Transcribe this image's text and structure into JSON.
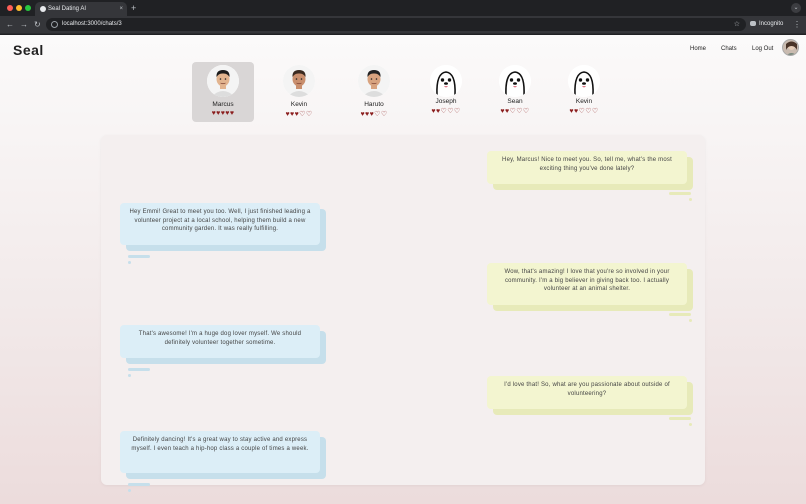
{
  "browser": {
    "tab_title": "Seal Dating AI",
    "tab_close": "×",
    "new_tab": "+",
    "url": "localhost:3000/chats/3",
    "incognito_label": "Incognito"
  },
  "app": {
    "logo": "Seal",
    "nav": {
      "home": "Home",
      "chats": "Chats",
      "logout": "Log Out"
    }
  },
  "matches": [
    {
      "name": "Marcus",
      "hearts": "♥♥♥♥♥",
      "active": true
    },
    {
      "name": "Kevin",
      "hearts": "♥♥♥♡♡",
      "active": false
    },
    {
      "name": "Haruto",
      "hearts": "♥♥♥♡♡",
      "active": false
    },
    {
      "name": "Joseph",
      "hearts": "♥♥♡♡♡",
      "active": false
    },
    {
      "name": "Sean",
      "hearts": "♥♥♡♡♡",
      "active": false
    },
    {
      "name": "Kevin",
      "hearts": "♥♥♡♡♡",
      "active": false
    }
  ],
  "messages": [
    {
      "from": "me",
      "text": "Hey, Marcus! Nice to meet you. So, tell me, what's the most exciting thing you've done lately?"
    },
    {
      "from": "them",
      "text": "Hey Emmi! Great to meet you too. Well, I just finished leading a volunteer project at a local school, helping them build a new community garden. It was really fulfilling."
    },
    {
      "from": "me",
      "text": "Wow, that's amazing! I love that you're so involved in your community. I'm a big believer in giving back too. I actually volunteer at an animal shelter."
    },
    {
      "from": "them",
      "text": "That's awesome! I'm a huge dog lover myself. We should definitely volunteer together sometime."
    },
    {
      "from": "me",
      "text": "I'd love that! So, what are you passionate about outside of volunteering?"
    },
    {
      "from": "them",
      "text": "Definitely dancing! It's a great way to stay active and express myself. I even teach a hip-hop class a couple of times a week."
    }
  ]
}
